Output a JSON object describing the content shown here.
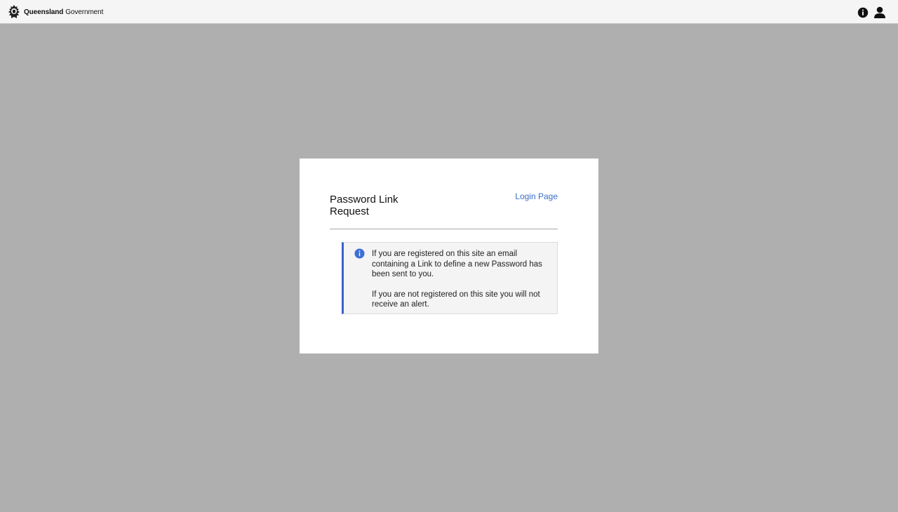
{
  "header": {
    "brand_bold": "Queensland",
    "brand_normal": "Government",
    "icons": [
      "crest-logo",
      "info-icon",
      "user-icon"
    ]
  },
  "card": {
    "title": "Password Link Request",
    "login_link": "Login Page",
    "alert": {
      "icon": "info-icon",
      "message_1": "If you are registered on this site an email containing a Link to define a new Password has been sent to you.",
      "message_2": "If you are not registered on this site you will not receive an alert."
    }
  },
  "colors": {
    "background": "#afafaf",
    "topbar": "#f5f5f5",
    "card": "#ffffff",
    "link": "#3b6fc7",
    "alert_border": "#3b63c9",
    "alert_bg": "#f4f4f4"
  }
}
